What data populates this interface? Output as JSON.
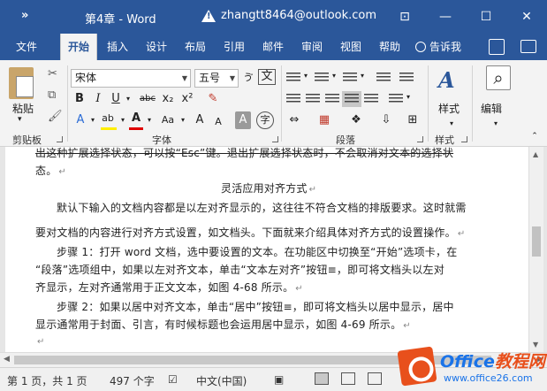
{
  "titlebar": {
    "qat": "»",
    "doc_title": "第4章 - Word",
    "account": "zhangtt8464@outlook.com",
    "ribbon_display_icon": "ribbon-display-icon",
    "minimize": "—",
    "maximize": "☐",
    "close": "✕"
  },
  "tabs": [
    "文件",
    "开始",
    "插入",
    "设计",
    "布局",
    "引用",
    "邮件",
    "审阅",
    "视图",
    "帮助"
  ],
  "active_tab": "开始",
  "tellme": "告诉我",
  "ribbon": {
    "clipboard": {
      "paste": "粘贴",
      "label": "剪贴板"
    },
    "font": {
      "font_name": "宋体",
      "font_size": "五号",
      "wen_button": "文",
      "bold": "B",
      "italic": "I",
      "underline": "U",
      "strike": "abc",
      "subscript": "x₂",
      "superscript": "x²",
      "font_color": "A",
      "highlight": "ab",
      "text_effects": "A",
      "change_case": "Aa",
      "grow": "A",
      "shrink": "A",
      "char_shading": "A",
      "enclose": "字",
      "label": "字体"
    },
    "paragraph": {
      "label": "段落"
    },
    "styles": {
      "styles_button": "样式",
      "label": "样式"
    },
    "editing": {
      "editing_button": "编辑"
    }
  },
  "accent_color": "#2b579a",
  "document": {
    "lines": [
      "出这种扩展选择状态，可以按“Esc”键。退出扩展选择状态时，不会取消对文本的选择状",
      "态。",
      "灵活应用对齐方式",
      "默认下输入的文档内容都是以左对齐显示的，这往往不符合文档的排版要求。这时就需",
      "要对文档的内容进行对齐方式设置，如文档头。下面就来介绍具体对齐方式的设置操作。",
      "步骤 1：打开 word 文档，选中要设置的文本。在功能区中切换至“开始”选项卡，在",
      "“段落”选项组中，如果以左对齐文本，单击“文本左对齐”按钮≡，即可将文档头以左对",
      "齐显示，左对齐通常用于正文文本，如图 4-68 所示。",
      "步骤 2：如果以居中对齐文本，单击“居中”按钮≡，即可将文档头以居中显示，居中",
      "显示通常用于封面、引言，有时候标题也会运用居中显示，如图 4-69 所示。",
      ""
    ],
    "paragraph_mark": "↵"
  },
  "statusbar": {
    "page": "第 1 页，共 1 页",
    "words": "497 个字",
    "language": "中文(中国)"
  },
  "watermark": {
    "brand": "Office",
    "brand_tail": "教程网",
    "site": "www.office26.com"
  }
}
